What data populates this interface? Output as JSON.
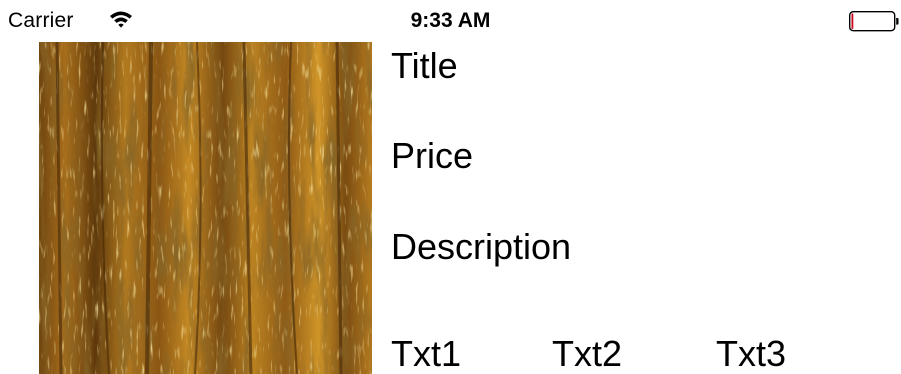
{
  "status_bar": {
    "carrier": "Carrier",
    "time": "9:33 AM",
    "wifi_icon": "wifi-icon",
    "battery_icon": "battery-icon"
  },
  "product": {
    "image_icon": "wood-texture-image",
    "title": "Title",
    "price": "Price",
    "description": "Description",
    "txt1": "Txt1",
    "txt2": "Txt2",
    "txt3": "Txt3"
  },
  "colors": {
    "wood_dark": "#5a3408",
    "wood_mid": "#8c5a12",
    "wood_light": "#c98e23",
    "battery_level": "#d0021b"
  }
}
